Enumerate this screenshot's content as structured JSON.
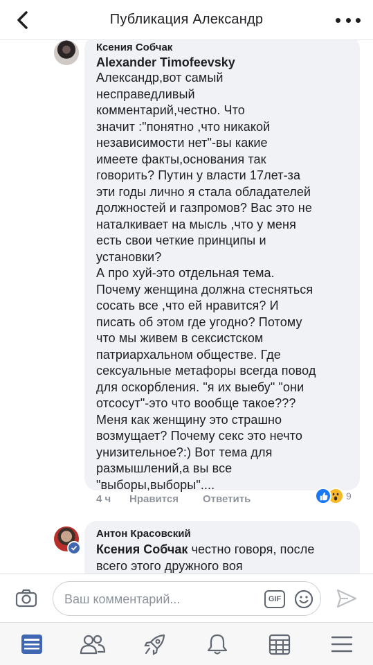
{
  "header": {
    "title": "Публикация Александр",
    "back_icon": "chevron-left-icon",
    "more_icon": "more-horizontal-icon"
  },
  "comment1": {
    "author": "Ксения Собчак",
    "mention": "Alexander Timofeevsky",
    "text": "Александр,вот самый\nнесправедливый\nкомментарий,честно. Что\nзначит :\"понятно ,что никакой\nнезависимости нет\"-вы какие\nимеете факты,основания так\nговорить? Путин у власти 17лет-за\nэти годы лично я стала обладателей\nдолжностей и газпромов? Вас это не\nнаталкивает на мысль ,что у меня\nесть свои четкие принципы и\nустановки?\nА про хуй-это отдельная тема.\nПочему женщина должна стесняться\nсосать все ,что ей нравится? И\nписать об этом где угодно? Потому\nчто мы живем в сексистском\nпатриархальном обществе. Где\nсексуальные метафоры всегда повод\nдля оскорбления. \"я их выебу\" \"они\nотсосут\"-это что вообще такое???\nМеня как женщину это страшно\nвозмущает? Почему секс это нечто\nунизительное?:) Вот тема для\nразмышлений,а вы все\n\"выборы,выборы\"....",
    "time": "4 ч",
    "like_label": "Нравится",
    "reply_label": "Ответить",
    "reaction_count": "9",
    "reactions": [
      "like-reaction-icon",
      "wow-reaction-icon"
    ]
  },
  "comment2": {
    "author": "Антон Красовский",
    "mention": "Ксения Собчак",
    "text": " честно говоря, после\nвсего этого дружного воя"
  },
  "composer": {
    "placeholder": "Ваш комментарий...",
    "gif_label": "GIF"
  },
  "nav": {
    "items": [
      "news-feed-icon",
      "friends-icon",
      "explore-rocket-icon",
      "notifications-bell-icon",
      "marketplace-icon",
      "menu-icon"
    ]
  },
  "colors": {
    "bubble": "#f0f2f5",
    "accent": "#4267b2",
    "muted": "#90949c",
    "wow": "#f7b928"
  }
}
